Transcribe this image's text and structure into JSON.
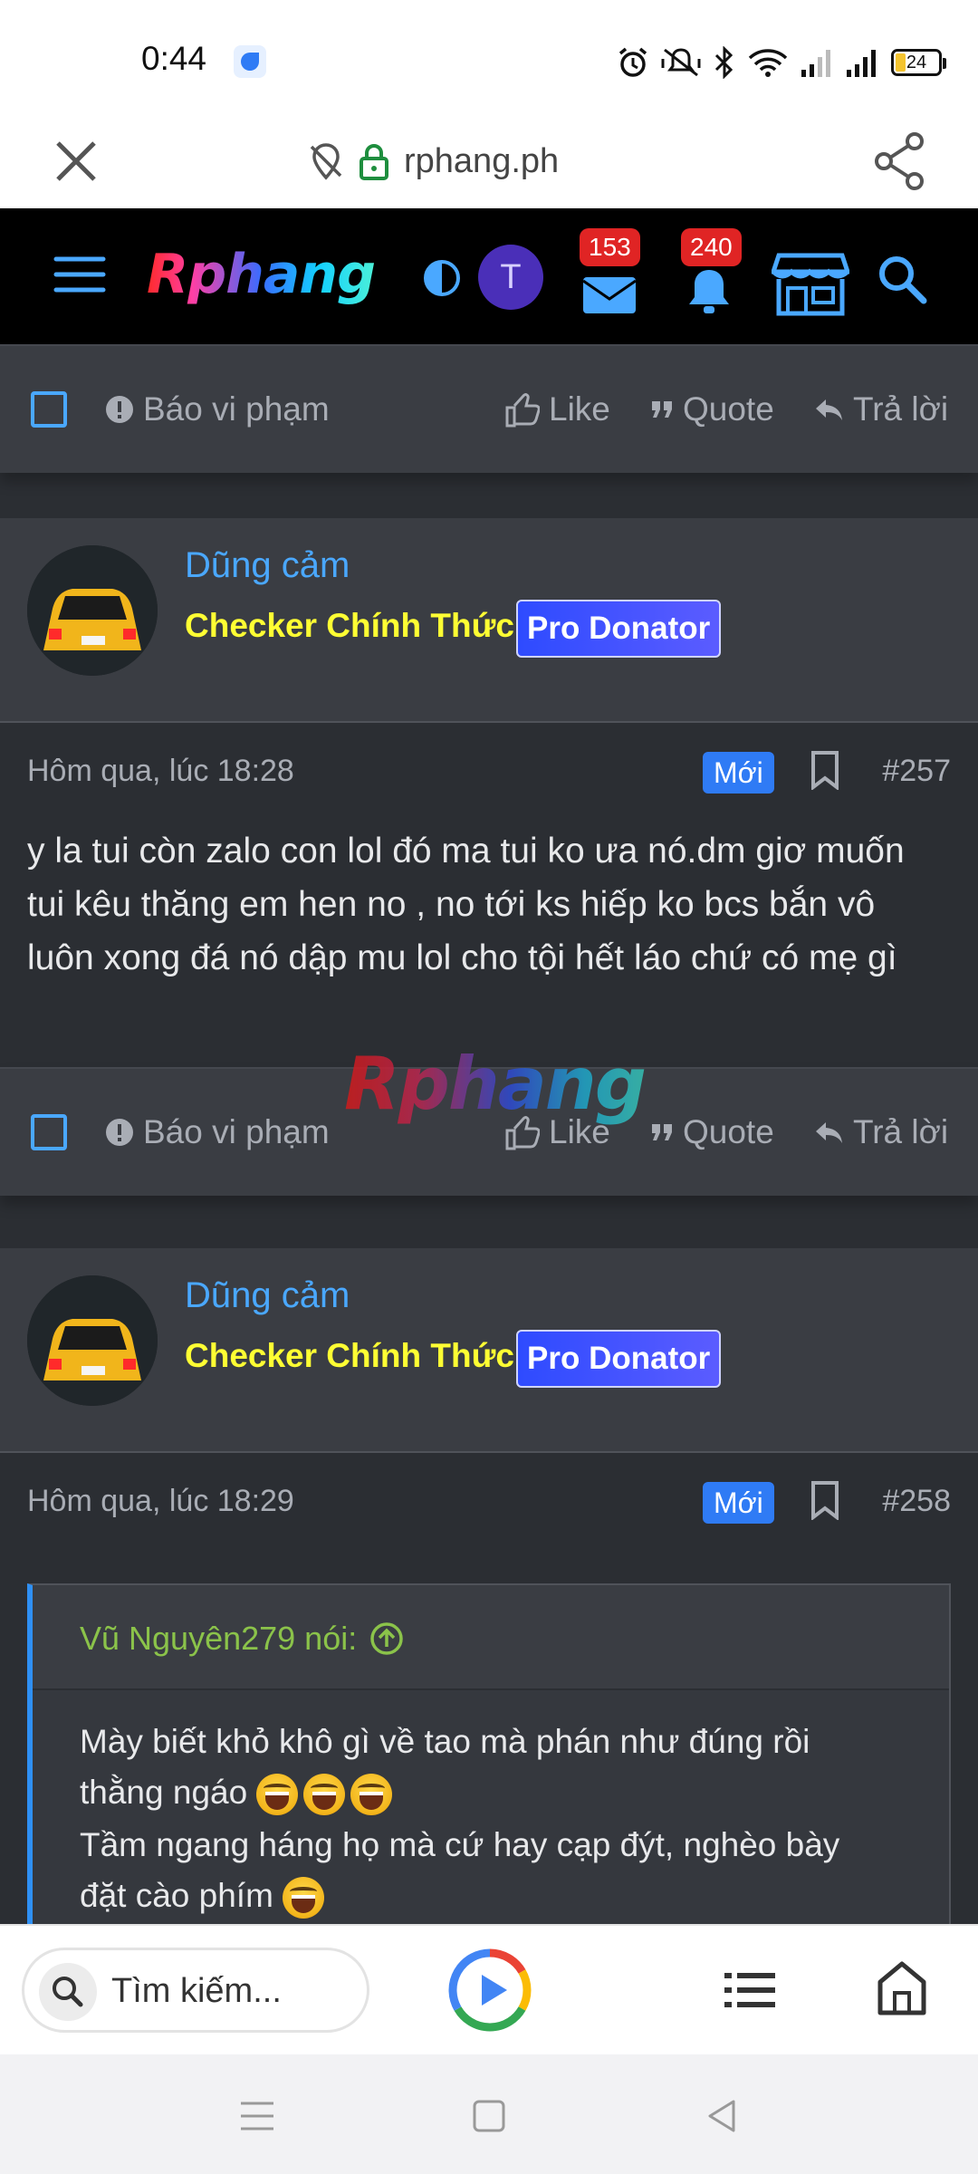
{
  "status_bar": {
    "time": "0:44",
    "battery": "24",
    "icons": [
      "alarm-icon",
      "mute-vibrate-icon",
      "bluetooth-icon",
      "wifi-icon",
      "signal-icon",
      "signal-icon",
      "battery-icon"
    ]
  },
  "browser": {
    "url": "rphang.ph",
    "search_placeholder": "Tìm kiếm..."
  },
  "site_header": {
    "logo": "Rphang",
    "avatar_letter": "T",
    "inbox_count": "153",
    "alerts_count": "240"
  },
  "actions": {
    "report": "Báo vi phạm",
    "like": "Like",
    "quote": "Quote",
    "reply": "Trả lời"
  },
  "posts": [
    {
      "username": "Dũng cảm",
      "user_title": "Checker Chính Thức",
      "banner": "Pro Donator",
      "date": "Hôm qua, lúc 18:28",
      "new_badge": "Mới",
      "number": "#257",
      "content": "y la tui còn zalo con lol đó ma tui ko ưa nó.dm giơ muốn tui kêu thăng em hen no , no tới ks hiếp ko bcs bắn vô luôn xong đá nó dập mu lol cho tội hết láo chứ có mẹ gì"
    },
    {
      "username": "Dũng cảm",
      "user_title": "Checker Chính Thức",
      "banner": "Pro Donator",
      "date": "Hôm qua, lúc 18:29",
      "new_badge": "Mới",
      "number": "#258",
      "quote_author": "Vũ Nguyên279 nói:",
      "quote_lines": [
        "Mày biết khỏ khô gì về tao mà phán như đúng rồi",
        "thằng ngáo",
        "Tầm ngang háng họ mà cứ hay cạp đýt, nghèo bày",
        "đặt cào phím"
      ]
    }
  ],
  "watermark": "Rphang",
  "colors": {
    "accent": "#4aa8ff",
    "user_title": "#ffff33",
    "new_badge": "#2f7bf5",
    "notification_badge": "#e02424",
    "quote_author": "#8bc34a"
  }
}
